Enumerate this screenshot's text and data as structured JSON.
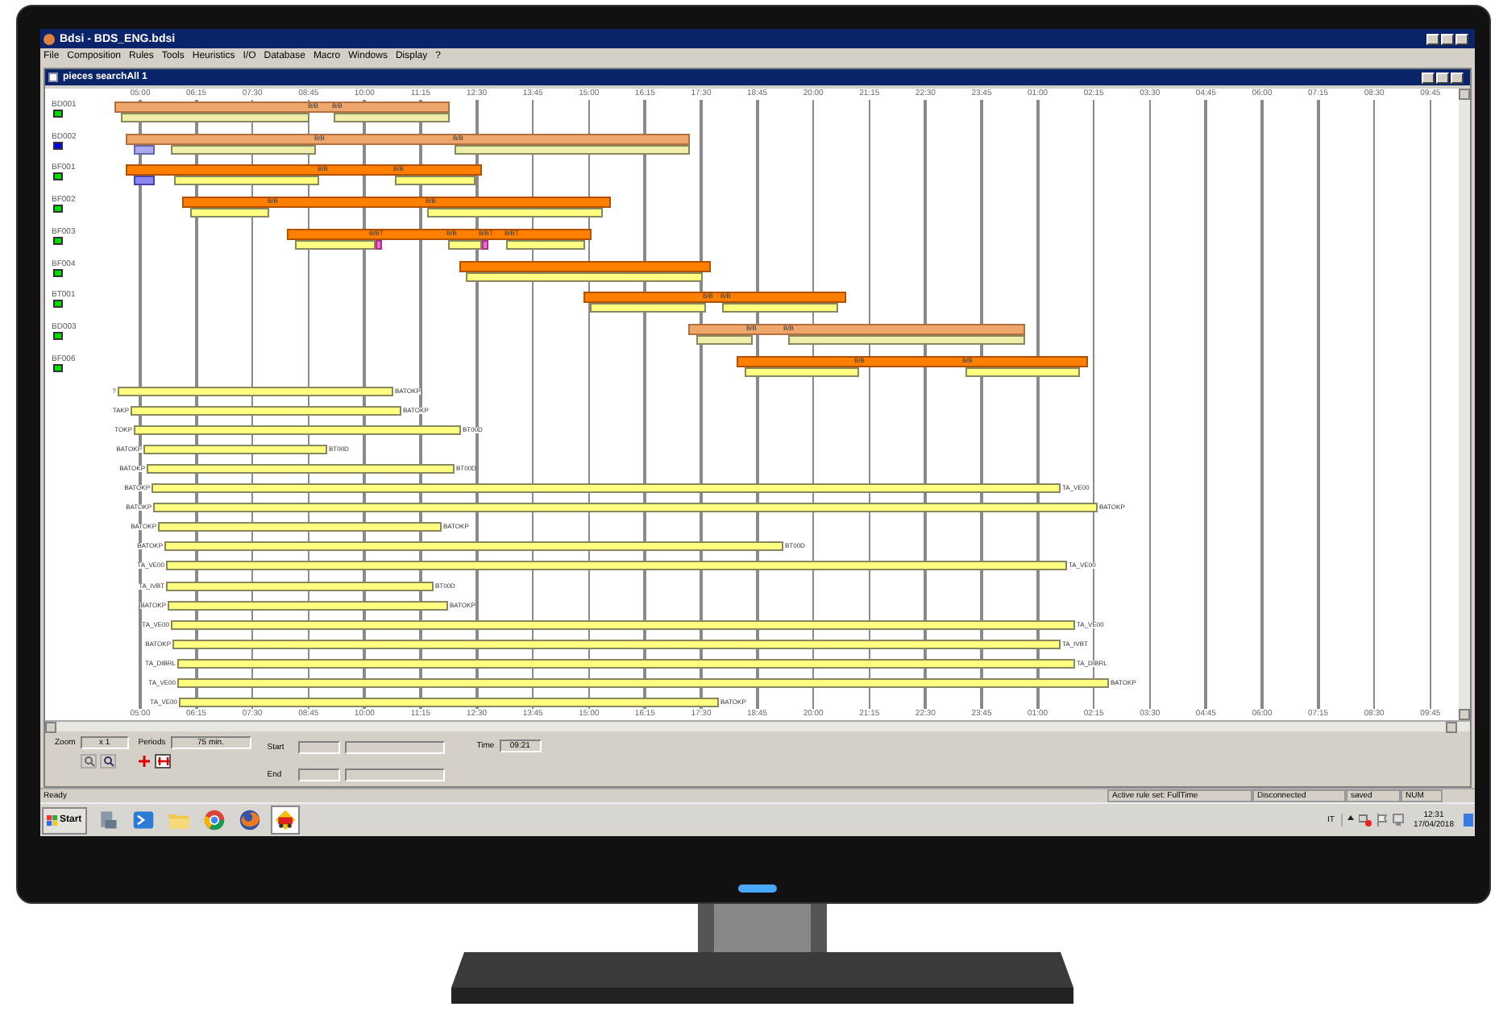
{
  "window": {
    "title": "Bdsi - BDS_ENG.bdsi"
  },
  "menu": [
    "File",
    "Composition",
    "Rules",
    "Tools",
    "Heuristics",
    "I/O",
    "Database",
    "Macro",
    "Windows",
    "Display",
    "?"
  ],
  "child_window": {
    "title": "pieces searchAll 1"
  },
  "timeline": {
    "ticks_top": [
      "05:00",
      "06:15",
      "07:30",
      "08:45",
      "10:00",
      "11:15",
      "12:30",
      "13:45",
      "15:00",
      "16:15",
      "17:30",
      "18:45",
      "20:00",
      "21:15",
      "22:30",
      "23:45",
      "01:00",
      "02:15",
      "03:30",
      "04:45",
      "06:00",
      "07:15",
      "08:30",
      "09:45"
    ],
    "ticks_bottom": [
      "05:00",
      "06:15",
      "07:30",
      "08:45",
      "10:00",
      "11:15",
      "12:30",
      "13:45",
      "15:00",
      "16:15",
      "17:30",
      "18:45",
      "20:00",
      "21:15",
      "22:30",
      "23:45",
      "01:00",
      "02:15",
      "03:30",
      "04:45",
      "06:00",
      "07:15",
      "08:30",
      "09:45"
    ]
  },
  "resources": [
    {
      "name": "BD001",
      "color": "#00dd00",
      "bar_labels": [
        "B/B",
        "B/B"
      ]
    },
    {
      "name": "BD002",
      "color": "#0000ee",
      "bar_labels": [
        "B/B",
        "B/B"
      ]
    },
    {
      "name": "BF001",
      "color": "#00dd00",
      "bar_labels": [
        "B/B",
        "B/B"
      ]
    },
    {
      "name": "BF002",
      "color": "#00dd00",
      "bar_labels": [
        "B/B",
        "B/B"
      ]
    },
    {
      "name": "BF003",
      "color": "#00dd00",
      "bar_labels": [
        "B/BT",
        "B/B",
        "B/BT",
        "B/BT"
      ]
    },
    {
      "name": "BF004",
      "color": "#00dd00"
    },
    {
      "name": "BT001",
      "color": "#00dd00",
      "bar_labels": [
        "B/B",
        "B/B"
      ]
    },
    {
      "name": "BD003",
      "color": "#00dd00",
      "bar_labels": [
        "B/B",
        "B/B"
      ]
    },
    {
      "name": "BF006",
      "color": "#00dd00",
      "bar_labels": [
        "B/B",
        "B/B"
      ]
    }
  ],
  "tasks": [
    {
      "left_label": "?",
      "right_label": "BATOKP"
    },
    {
      "left_label": "TAKP",
      "right_label": "BATOKP"
    },
    {
      "left_label": "TOKP",
      "right_label": "BT00D"
    },
    {
      "left_label": "BATOKP",
      "right_label": "BT00D"
    },
    {
      "left_label": "BATOKP",
      "right_label": "BT00D"
    },
    {
      "left_label": "BATOKP",
      "right_label": "TA_VE00"
    },
    {
      "left_label": "BATOKP",
      "right_label": "BATOKP"
    },
    {
      "left_label": "BATOKP",
      "right_label": "BATOKP"
    },
    {
      "left_label": "BATOKP",
      "right_label": "BT00D"
    },
    {
      "left_label": "TA_VE00",
      "right_label": "TA_VE00"
    },
    {
      "left_label": "TA_IVBT",
      "right_label": "BT00D"
    },
    {
      "left_label": "BATOKP",
      "right_label": "BATOKP"
    },
    {
      "left_label": "TA_VE00",
      "right_label": "TA_VE00"
    },
    {
      "left_label": "BATOKP",
      "right_label": "TA_IVBT"
    },
    {
      "left_label": "TA_DIBRL",
      "right_label": "TA_DIBRL"
    },
    {
      "left_label": "TA_VE00",
      "right_label": "BATOKP"
    },
    {
      "left_label": "TA_VE00",
      "right_label": "BATOKP"
    }
  ],
  "controls": {
    "zoom_label": "Zoom",
    "zoom": "x 1",
    "periods_label": "Periods",
    "periods": "75 min.",
    "start_label": "Start",
    "end_label": "End",
    "time_label": "Time",
    "time": "09:21"
  },
  "status_bar": [
    "Ready",
    "Active rule set: FullTime",
    "Disconnected",
    "saved",
    "NUM"
  ],
  "taskbar": {
    "start": "Start",
    "language": "IT",
    "clock_time": "12:31",
    "clock_date": "17/04/2018"
  }
}
